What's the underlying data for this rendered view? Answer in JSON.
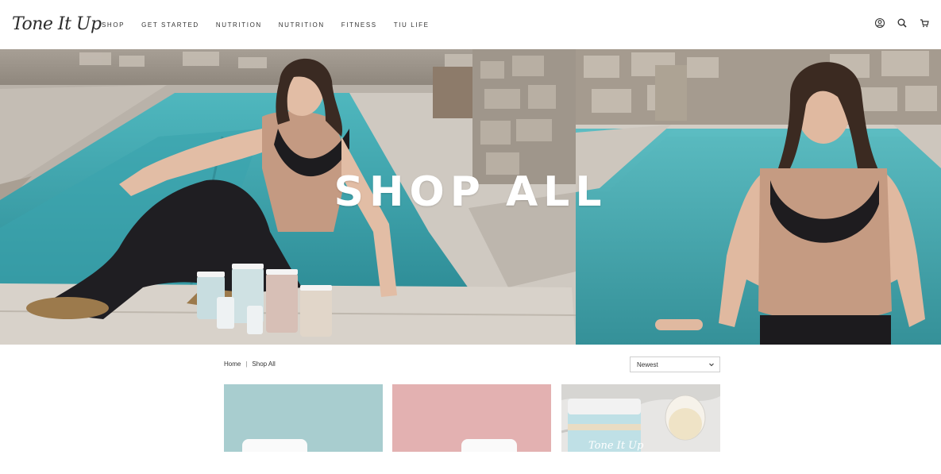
{
  "brand": {
    "logo_text": "Tone It Up"
  },
  "nav": {
    "items": [
      {
        "label": "SHOP"
      },
      {
        "label": "GET STARTED"
      },
      {
        "label": "NUTRITION"
      },
      {
        "label": "NUTRITION"
      },
      {
        "label": "FITNESS"
      },
      {
        "label": "TIU LIFE"
      }
    ]
  },
  "header_icons": [
    "account-icon",
    "search-icon",
    "cart-icon"
  ],
  "hero": {
    "title": "SHOP ALL"
  },
  "breadcrumb": {
    "home": "Home",
    "separator": "|",
    "current": "Shop All"
  },
  "sort": {
    "selected": "Newest"
  },
  "products": [
    {
      "bg_color": "#a8cdcf"
    },
    {
      "bg_color": "#e3b1b1"
    },
    {
      "bg_color": "#e7e6e4",
      "label_text": "Tone It Up"
    }
  ],
  "colors": {
    "pool": "#3aa8b0",
    "stone": "#b7ada2",
    "tan_top": "#c49a82"
  }
}
